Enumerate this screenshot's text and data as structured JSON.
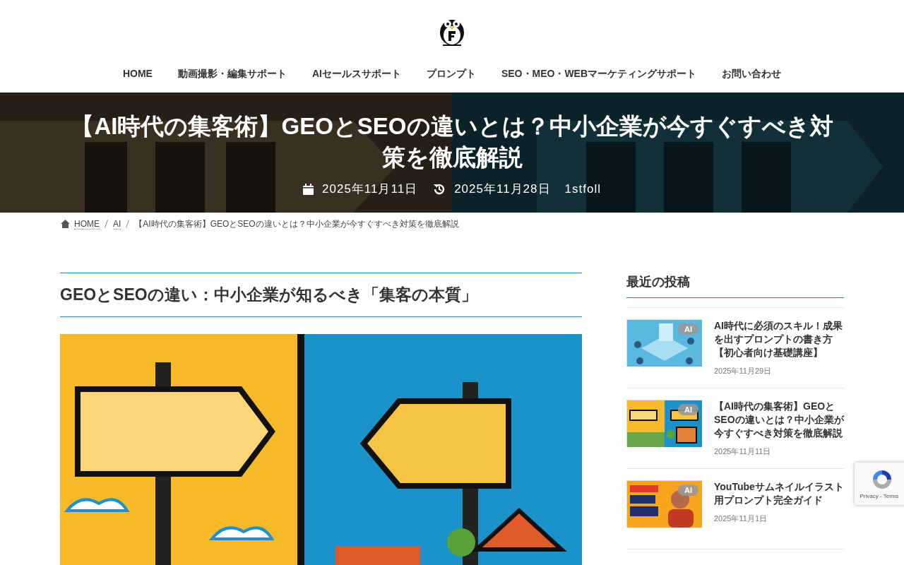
{
  "nav": [
    {
      "label": "HOME"
    },
    {
      "label": "動画撮影・編集サポート"
    },
    {
      "label": "AIセールスサポート"
    },
    {
      "label": "プロンプト"
    },
    {
      "label": "SEO・MEO・WEBマーケティングサポート"
    },
    {
      "label": "お問い合わせ"
    }
  ],
  "hero": {
    "title": "【AI時代の集客術】GEOとSEOの違いとは？中小企業が今すぐすべき対策を徹底解説",
    "published": "2025年11月11日",
    "updated": "2025年11月28日",
    "author": "1stfoll"
  },
  "breadcrumb": [
    {
      "label": "HOME",
      "kind": "link"
    },
    {
      "label": "AI",
      "kind": "link"
    },
    {
      "label": "【AI時代の集客術】GEOとSEOの違いとは？中小企業が今すぐすべき対策を徹底解説",
      "kind": "current"
    }
  ],
  "article": {
    "heading": "GEOとSEOの違い：中小企業が知るべき「集客の本質」"
  },
  "sidebar": {
    "heading": "最近の投稿",
    "posts": [
      {
        "title": "AI時代に必須のスキル！成果を出すプロンプトの書き方【初心者向け基礎講座】",
        "date": "2025年11月29日",
        "category": "AI"
      },
      {
        "title": "【AI時代の集客術】GEOとSEOの違いとは？中小企業が今すぐすべき対策を徹底解説",
        "date": "2025年11月11日",
        "category": "AI"
      },
      {
        "title": "YouTubeサムネイルイラスト用プロンプト完全ガイド",
        "date": "2025年11月1日",
        "category": "AI"
      }
    ]
  },
  "recaptcha": {
    "links": "Privacy - Terms"
  }
}
